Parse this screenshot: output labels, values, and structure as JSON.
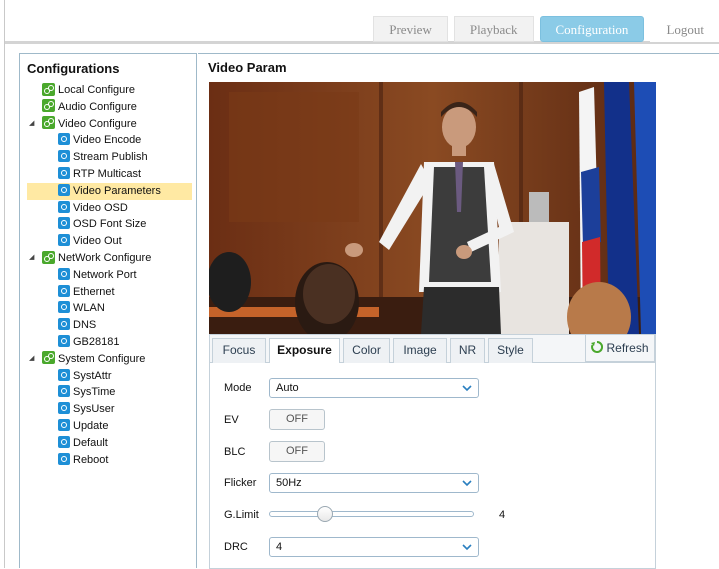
{
  "nav": {
    "preview": "Preview",
    "playback": "Playback",
    "configuration": "Configuration",
    "logout": "Logout"
  },
  "sidebar": {
    "title": "Configurations",
    "items": [
      {
        "label": "Local Configure",
        "level": 1,
        "icon": "green-gear-icon"
      },
      {
        "label": "Audio Configure",
        "level": 1,
        "icon": "green-gear-icon"
      },
      {
        "label": "Video Configure",
        "level": 1,
        "icon": "green-gear-icon",
        "expanded": true
      },
      {
        "label": "Video Encode",
        "level": 2,
        "icon": "blue-gear-icon"
      },
      {
        "label": "Stream Publish",
        "level": 2,
        "icon": "blue-gear-icon"
      },
      {
        "label": "RTP Multicast",
        "level": 2,
        "icon": "blue-gear-icon"
      },
      {
        "label": "Video Parameters",
        "level": 2,
        "icon": "blue-gear-icon",
        "selected": true
      },
      {
        "label": "Video OSD",
        "level": 2,
        "icon": "blue-gear-icon"
      },
      {
        "label": "OSD Font Size",
        "level": 2,
        "icon": "blue-gear-icon"
      },
      {
        "label": "Video Out",
        "level": 2,
        "icon": "blue-gear-icon"
      },
      {
        "label": "NetWork Configure",
        "level": 1,
        "icon": "green-gear-icon",
        "expanded": true
      },
      {
        "label": "Network Port",
        "level": 2,
        "icon": "blue-gear-icon"
      },
      {
        "label": "Ethernet",
        "level": 2,
        "icon": "blue-gear-icon"
      },
      {
        "label": "WLAN",
        "level": 2,
        "icon": "blue-gear-icon"
      },
      {
        "label": "DNS",
        "level": 2,
        "icon": "blue-gear-icon"
      },
      {
        "label": "GB28181",
        "level": 2,
        "icon": "blue-gear-icon"
      },
      {
        "label": "System Configure",
        "level": 1,
        "icon": "green-gear-icon",
        "expanded": true
      },
      {
        "label": "SystAttr",
        "level": 2,
        "icon": "blue-gear-icon"
      },
      {
        "label": "SysTime",
        "level": 2,
        "icon": "blue-gear-icon"
      },
      {
        "label": "SysUser",
        "level": 2,
        "icon": "blue-gear-icon"
      },
      {
        "label": "Update",
        "level": 2,
        "icon": "blue-gear-icon"
      },
      {
        "label": "Default",
        "level": 2,
        "icon": "blue-gear-icon"
      },
      {
        "label": "Reboot",
        "level": 2,
        "icon": "blue-gear-icon"
      }
    ]
  },
  "main": {
    "title": "Video Param",
    "tabs": [
      {
        "label": "Focus"
      },
      {
        "label": "Exposure",
        "active": true
      },
      {
        "label": "Color"
      },
      {
        "label": "Image"
      },
      {
        "label": "NR"
      },
      {
        "label": "Style"
      }
    ],
    "refresh_label": "Refresh",
    "exposure": {
      "mode_label": "Mode",
      "mode_value": "Auto",
      "ev_label": "EV",
      "ev_value": "OFF",
      "blc_label": "BLC",
      "blc_value": "OFF",
      "flicker_label": "Flicker",
      "flicker_value": "50Hz",
      "glimit_label": "G.Limit",
      "glimit_value": "4",
      "glimit_fraction": 0.27,
      "drc_label": "DRC",
      "drc_value": "4"
    }
  },
  "colors": {
    "accent": "#8bcbe7",
    "selected_row": "#ffe9a3",
    "green_icon": "#4aa82c",
    "blue_icon": "#1e8fd6"
  }
}
